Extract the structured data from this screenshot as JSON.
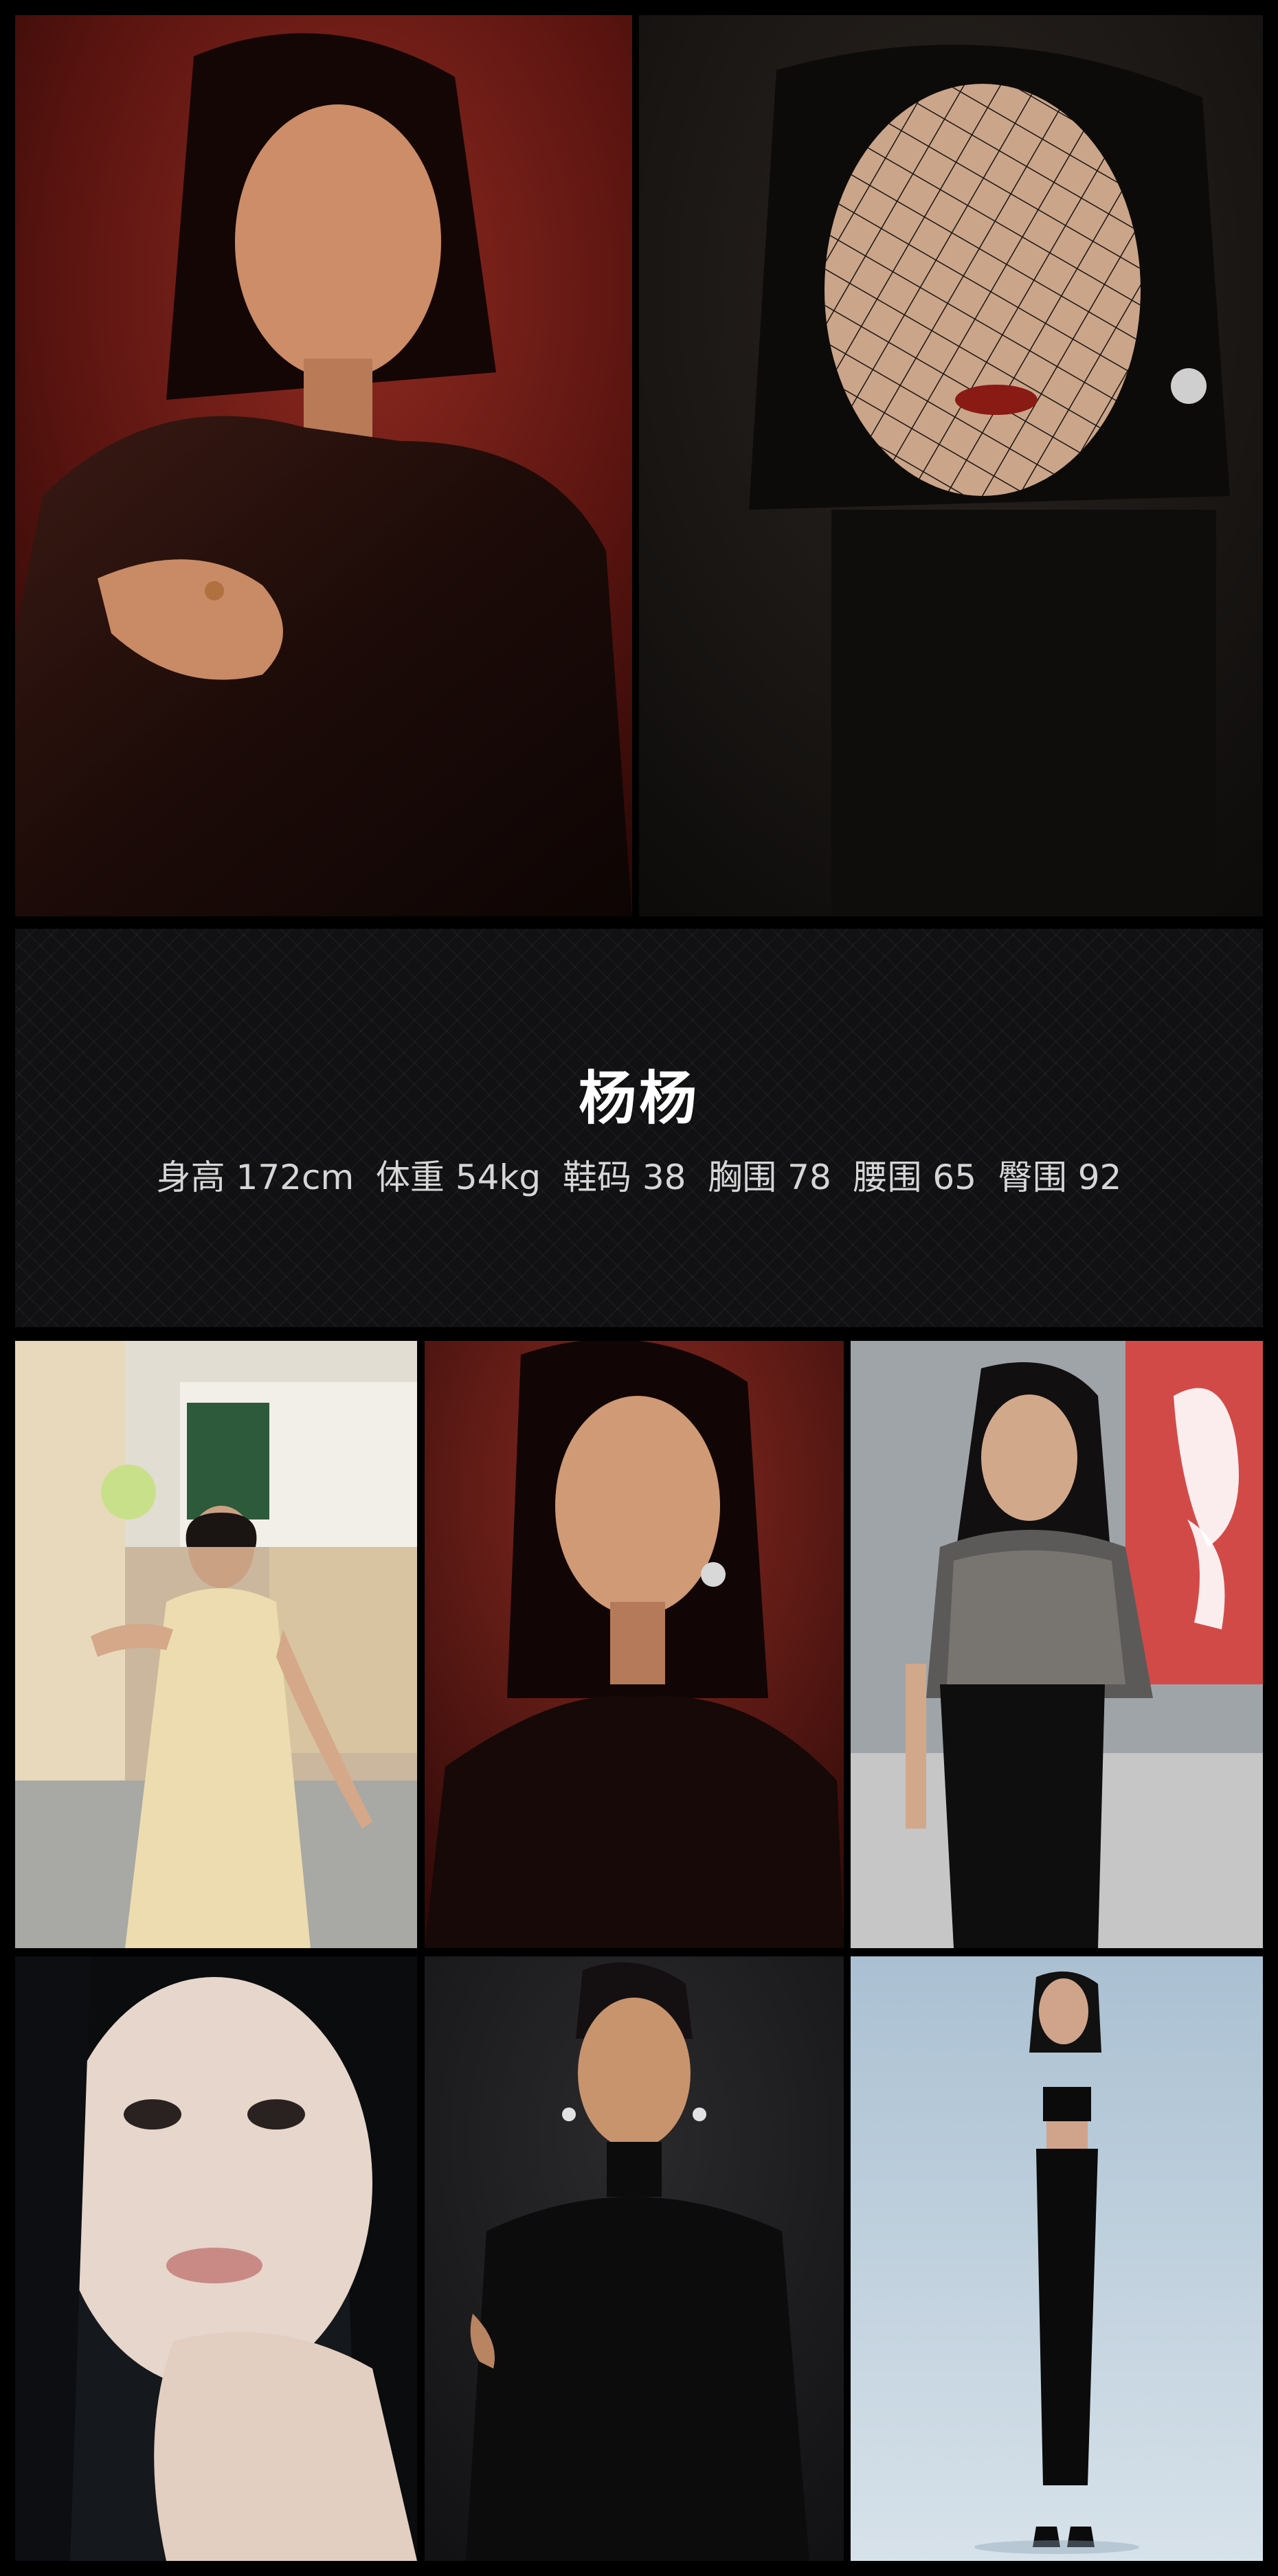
{
  "profile": {
    "name": "杨杨",
    "stats": "身高 172cm  体重 54kg  鞋码 38  胸围 78  腰围 65  臀围 92"
  },
  "colors": {
    "page_background": "#000000",
    "info_band_background": "#111113",
    "name_text": "#ffffff",
    "stats_text": "#d6d6d6"
  },
  "photos": [
    {
      "id": "portrait-red-leather",
      "icon": "photo-portrait"
    },
    {
      "id": "portrait-net-veil",
      "icon": "photo-portrait"
    },
    {
      "id": "cream-dress-cafe",
      "icon": "photo-full-body"
    },
    {
      "id": "portrait-red-backdrop",
      "icon": "photo-portrait"
    },
    {
      "id": "sequin-top-street",
      "icon": "photo-full-body"
    },
    {
      "id": "closeup-hand-chin",
      "icon": "photo-closeup"
    },
    {
      "id": "black-turtleneck-studio",
      "icon": "photo-portrait"
    },
    {
      "id": "black-outfit-blue-studio",
      "icon": "photo-full-body"
    }
  ]
}
